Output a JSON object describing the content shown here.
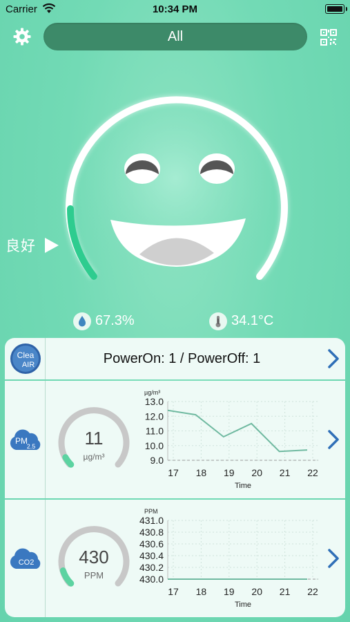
{
  "status_bar": {
    "carrier": "Carrier",
    "time": "10:34 PM"
  },
  "header": {
    "selector_label": "All",
    "settings_icon": "gear-icon",
    "scan_icon": "qr-code-icon"
  },
  "air_status": {
    "label": "良好",
    "play_icon": "play-icon"
  },
  "environment": {
    "humidity": "67.3%",
    "temperature": "34.1°C"
  },
  "device_card": {
    "logo_text_top": "Clea",
    "logo_text_bottom": "AIR",
    "text": "PowerOn: 1 / PowerOff: 1"
  },
  "pm25": {
    "badge_main": "PM",
    "badge_sub": "2.5",
    "value": "11",
    "unit": "µg/m³",
    "gauge_fraction": 0.06,
    "chart_data": {
      "type": "line",
      "ylabel": "µg/m³",
      "xlabel": "Time",
      "x": [
        17,
        18,
        19,
        20,
        21,
        22
      ],
      "y_ticks": [
        "13.0",
        "12.0",
        "11.0",
        "10.0",
        "9.0"
      ],
      "ylim": [
        9.0,
        13.0
      ],
      "values": [
        12.4,
        12.1,
        10.6,
        11.5,
        9.6,
        9.7
      ]
    }
  },
  "co2": {
    "badge": "CO2",
    "value": "430",
    "unit": "PPM",
    "gauge_fraction": 0.1,
    "chart_data": {
      "type": "line",
      "ylabel": "PPM",
      "xlabel": "Time",
      "x": [
        17,
        18,
        19,
        20,
        21,
        22
      ],
      "y_ticks": [
        "431.0",
        "430.8",
        "430.6",
        "430.4",
        "430.2",
        "430.0"
      ],
      "ylim": [
        430.0,
        431.0
      ],
      "values": [
        430.0,
        430.0,
        430.0,
        430.0,
        430.0,
        430.0
      ]
    }
  },
  "colors": {
    "accent": "#2ecc8f",
    "selector_bg": "#3d8a69",
    "line": "#6fb9a0",
    "chevron": "#2f6fb7"
  }
}
